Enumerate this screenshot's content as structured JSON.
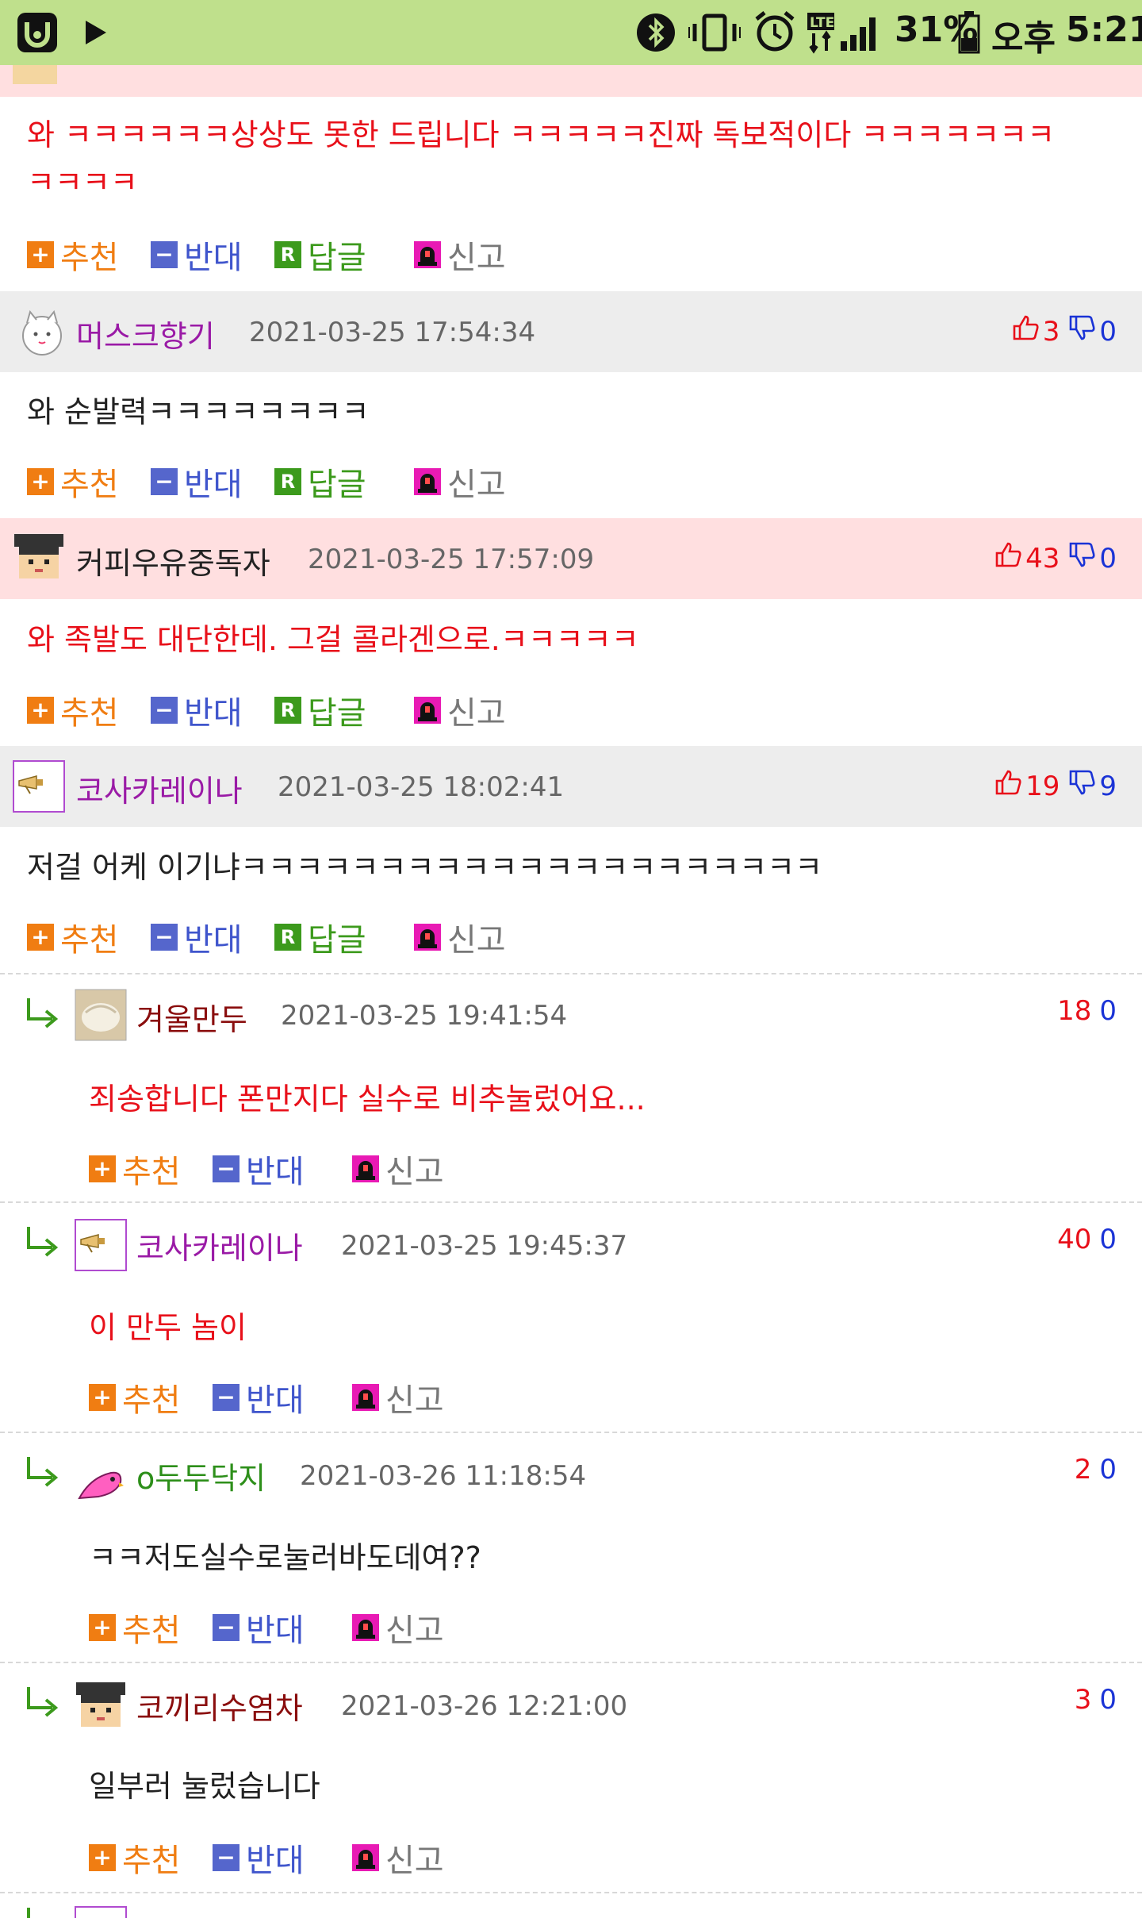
{
  "status_bar": {
    "battery": "31%",
    "ampm": "오후",
    "time": "5:21"
  },
  "colors": {
    "status_bar_bg": "#bfe08c",
    "best_row_bg": "#ffdfe0",
    "normal_row_bg": "#ededed",
    "recommend": "#f07d12",
    "oppose": "#3f55cc",
    "reply": "#3c9a1c",
    "red_text": "#e8101a"
  },
  "actions": {
    "recommend": "추천",
    "oppose": "반대",
    "reply": "답글",
    "report": "신고"
  },
  "comments": [
    {
      "message_lines": [
        "와 ㅋㅋㅋㅋㅋㅋ상상도 못한 드립니다 ㅋㅋㅋㅋㅋ진짜 독보적이다 ㅋㅋㅋㅋㅋㅋㅋ",
        "ㅋㅋㅋㅋ"
      ]
    },
    {
      "nick": "머스크향기",
      "date": "2021-03-25 17:54:34",
      "up": "3",
      "down": "0",
      "message": "와 순발력ㅋㅋㅋㅋㅋㅋㅋㅋ"
    },
    {
      "nick": "커피우유중독자",
      "date": "2021-03-25 17:57:09",
      "up": "43",
      "down": "0",
      "message": "와 족발도 대단한데. 그걸 콜라겐으로.ㅋㅋㅋㅋㅋ"
    },
    {
      "nick": "코사카레이나",
      "date": "2021-03-25 18:02:41",
      "up": "19",
      "down": "9",
      "message": "저걸 어케 이기냐ㅋㅋㅋㅋㅋㅋㅋㅋㅋㅋㅋㅋㅋㅋㅋㅋㅋㅋㅋㅋㅋ"
    }
  ],
  "replies": [
    {
      "nick": "겨울만두",
      "date": "2021-03-25 19:41:54",
      "up": "18",
      "down": "0",
      "message": "죄송합니다 폰만지다 실수로 비추눌렀어요..."
    },
    {
      "nick": "코사카레이나",
      "date": "2021-03-25 19:45:37",
      "up": "40",
      "down": "0",
      "message": "이 만두 놈이"
    },
    {
      "nick": "o두두닥지",
      "date": "2021-03-26 11:18:54",
      "up": "2",
      "down": "0",
      "message": "ㅋㅋ저도실수로눌러바도데여??"
    },
    {
      "nick": "코끼리수염차",
      "date": "2021-03-26 12:21:00",
      "up": "3",
      "down": "0",
      "message": "일부러 눌렀습니다"
    }
  ]
}
